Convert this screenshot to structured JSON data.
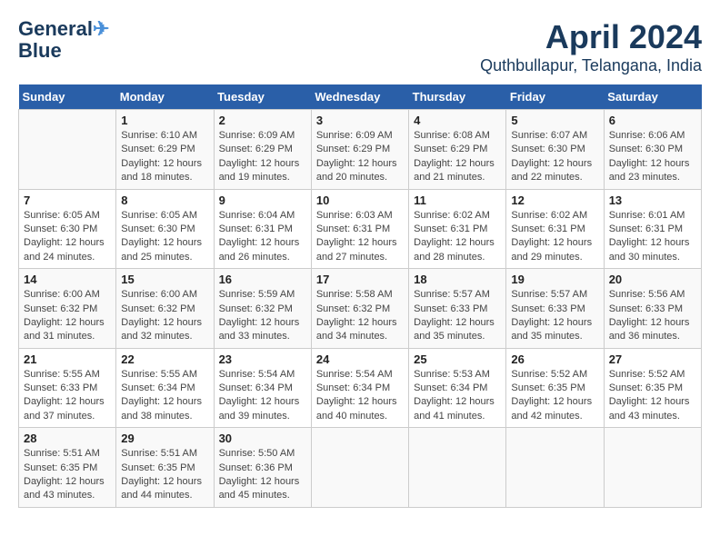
{
  "header": {
    "logo_line1": "General",
    "logo_line2": "Blue",
    "month": "April 2024",
    "location": "Quthbullapur, Telangana, India"
  },
  "days_of_week": [
    "Sunday",
    "Monday",
    "Tuesday",
    "Wednesday",
    "Thursday",
    "Friday",
    "Saturday"
  ],
  "weeks": [
    [
      {
        "day": "",
        "info": ""
      },
      {
        "day": "1",
        "info": "Sunrise: 6:10 AM\nSunset: 6:29 PM\nDaylight: 12 hours\nand 18 minutes."
      },
      {
        "day": "2",
        "info": "Sunrise: 6:09 AM\nSunset: 6:29 PM\nDaylight: 12 hours\nand 19 minutes."
      },
      {
        "day": "3",
        "info": "Sunrise: 6:09 AM\nSunset: 6:29 PM\nDaylight: 12 hours\nand 20 minutes."
      },
      {
        "day": "4",
        "info": "Sunrise: 6:08 AM\nSunset: 6:29 PM\nDaylight: 12 hours\nand 21 minutes."
      },
      {
        "day": "5",
        "info": "Sunrise: 6:07 AM\nSunset: 6:30 PM\nDaylight: 12 hours\nand 22 minutes."
      },
      {
        "day": "6",
        "info": "Sunrise: 6:06 AM\nSunset: 6:30 PM\nDaylight: 12 hours\nand 23 minutes."
      }
    ],
    [
      {
        "day": "7",
        "info": "Sunrise: 6:05 AM\nSunset: 6:30 PM\nDaylight: 12 hours\nand 24 minutes."
      },
      {
        "day": "8",
        "info": "Sunrise: 6:05 AM\nSunset: 6:30 PM\nDaylight: 12 hours\nand 25 minutes."
      },
      {
        "day": "9",
        "info": "Sunrise: 6:04 AM\nSunset: 6:31 PM\nDaylight: 12 hours\nand 26 minutes."
      },
      {
        "day": "10",
        "info": "Sunrise: 6:03 AM\nSunset: 6:31 PM\nDaylight: 12 hours\nand 27 minutes."
      },
      {
        "day": "11",
        "info": "Sunrise: 6:02 AM\nSunset: 6:31 PM\nDaylight: 12 hours\nand 28 minutes."
      },
      {
        "day": "12",
        "info": "Sunrise: 6:02 AM\nSunset: 6:31 PM\nDaylight: 12 hours\nand 29 minutes."
      },
      {
        "day": "13",
        "info": "Sunrise: 6:01 AM\nSunset: 6:31 PM\nDaylight: 12 hours\nand 30 minutes."
      }
    ],
    [
      {
        "day": "14",
        "info": "Sunrise: 6:00 AM\nSunset: 6:32 PM\nDaylight: 12 hours\nand 31 minutes."
      },
      {
        "day": "15",
        "info": "Sunrise: 6:00 AM\nSunset: 6:32 PM\nDaylight: 12 hours\nand 32 minutes."
      },
      {
        "day": "16",
        "info": "Sunrise: 5:59 AM\nSunset: 6:32 PM\nDaylight: 12 hours\nand 33 minutes."
      },
      {
        "day": "17",
        "info": "Sunrise: 5:58 AM\nSunset: 6:32 PM\nDaylight: 12 hours\nand 34 minutes."
      },
      {
        "day": "18",
        "info": "Sunrise: 5:57 AM\nSunset: 6:33 PM\nDaylight: 12 hours\nand 35 minutes."
      },
      {
        "day": "19",
        "info": "Sunrise: 5:57 AM\nSunset: 6:33 PM\nDaylight: 12 hours\nand 35 minutes."
      },
      {
        "day": "20",
        "info": "Sunrise: 5:56 AM\nSunset: 6:33 PM\nDaylight: 12 hours\nand 36 minutes."
      }
    ],
    [
      {
        "day": "21",
        "info": "Sunrise: 5:55 AM\nSunset: 6:33 PM\nDaylight: 12 hours\nand 37 minutes."
      },
      {
        "day": "22",
        "info": "Sunrise: 5:55 AM\nSunset: 6:34 PM\nDaylight: 12 hours\nand 38 minutes."
      },
      {
        "day": "23",
        "info": "Sunrise: 5:54 AM\nSunset: 6:34 PM\nDaylight: 12 hours\nand 39 minutes."
      },
      {
        "day": "24",
        "info": "Sunrise: 5:54 AM\nSunset: 6:34 PM\nDaylight: 12 hours\nand 40 minutes."
      },
      {
        "day": "25",
        "info": "Sunrise: 5:53 AM\nSunset: 6:34 PM\nDaylight: 12 hours\nand 41 minutes."
      },
      {
        "day": "26",
        "info": "Sunrise: 5:52 AM\nSunset: 6:35 PM\nDaylight: 12 hours\nand 42 minutes."
      },
      {
        "day": "27",
        "info": "Sunrise: 5:52 AM\nSunset: 6:35 PM\nDaylight: 12 hours\nand 43 minutes."
      }
    ],
    [
      {
        "day": "28",
        "info": "Sunrise: 5:51 AM\nSunset: 6:35 PM\nDaylight: 12 hours\nand 43 minutes."
      },
      {
        "day": "29",
        "info": "Sunrise: 5:51 AM\nSunset: 6:35 PM\nDaylight: 12 hours\nand 44 minutes."
      },
      {
        "day": "30",
        "info": "Sunrise: 5:50 AM\nSunset: 6:36 PM\nDaylight: 12 hours\nand 45 minutes."
      },
      {
        "day": "",
        "info": ""
      },
      {
        "day": "",
        "info": ""
      },
      {
        "day": "",
        "info": ""
      },
      {
        "day": "",
        "info": ""
      }
    ]
  ]
}
